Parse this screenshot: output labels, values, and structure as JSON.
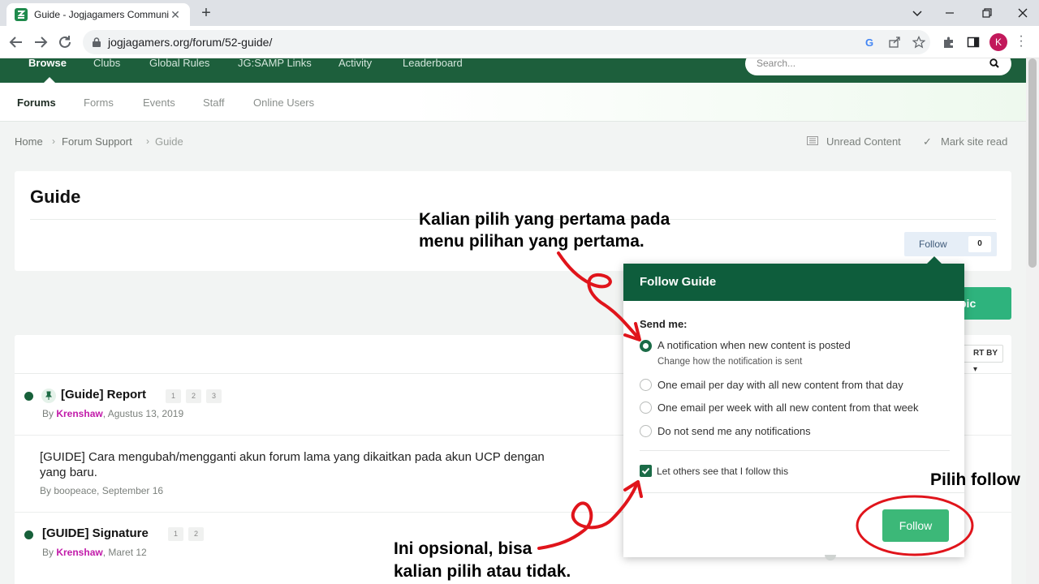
{
  "browser": {
    "tab_title": "Guide - Jogjagamers Communit",
    "url": "jogjagamers.org/forum/52-guide/",
    "profile_initial": "K",
    "colors": {
      "tabbar": "#dee1e6",
      "profile": "#c2185b"
    }
  },
  "nav": {
    "items": [
      "Browse",
      "Clubs",
      "Global Rules",
      "JG:SAMP Links",
      "Activity",
      "Leaderboard"
    ],
    "active": "Browse",
    "search_placeholder": "Search..."
  },
  "subnav": {
    "items": [
      "Forums",
      "Forms",
      "Events",
      "Staff",
      "Online Users"
    ],
    "active": "Forums"
  },
  "breadcrumb": {
    "items": [
      "Home",
      "Forum Support",
      "Guide"
    ],
    "unread": "Unread Content",
    "mark_read": "Mark site read"
  },
  "page": {
    "title": "Guide",
    "follow_label": "Follow",
    "follow_count": "0",
    "start_topic_partial": "pic",
    "sort_partial": "RT BY"
  },
  "topics": [
    {
      "title": "[Guide] Report",
      "pinned": true,
      "unread": true,
      "pages": [
        "1",
        "2",
        "3"
      ],
      "meta_prefix": "By ",
      "author": "Krenshaw",
      "date": ", Agustus 13, 2019"
    },
    {
      "title_line1": "[GUIDE] Cara mengubah/mengganti akun forum lama yang dikaitkan pada akun UCP dengan",
      "title_line2": "yang baru.",
      "meta": "By boopeace, September 16"
    },
    {
      "title": "[GUIDE] Signature",
      "unread": true,
      "pages": [
        "1",
        "2"
      ],
      "meta_prefix": "By ",
      "author": "Krenshaw",
      "date": ", Maret 12"
    }
  ],
  "modal": {
    "title": "Follow Guide",
    "send_label": "Send me:",
    "options": [
      "A notification when new content is posted",
      "One email per day with all new content from that day",
      "One email per week with all new content from that week",
      "Do not send me any notifications"
    ],
    "selected_index": 0,
    "option0_sub": "Change how the notification is sent",
    "checkbox_label": "Let others see that I follow this",
    "checkbox_checked": true,
    "follow_button": "Follow",
    "colors": {
      "header": "#0e5d3c",
      "button": "#3cb878"
    }
  },
  "annotations": {
    "top_line1": "Kalian pilih yang pertama pada",
    "top_line2": "menu pilihan yang pertama.",
    "right": "Pilih follow",
    "bottom_line1": "Ini opsional, bisa",
    "bottom_line2": "kalian pilih atau tidak.",
    "color": "#e0141b"
  },
  "colors": {
    "nav": "#1d5f3c",
    "author": "#c11aa9",
    "accent_green": "#2eb37d"
  }
}
